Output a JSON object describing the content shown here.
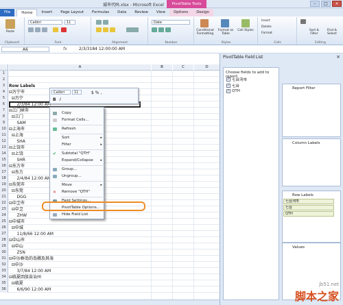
{
  "window": {
    "title": "城市代码.xlsx - Microsoft Excel",
    "contextual_tab": "PivotTable Tools",
    "buttons": [
      "–",
      "□",
      "×"
    ]
  },
  "ribbon_tabs": [
    "File",
    "Home",
    "Insert",
    "Page Layout",
    "Formulas",
    "Data",
    "Review",
    "View",
    "Options",
    "Design"
  ],
  "ribbon": {
    "clipboard": {
      "paste": "Paste",
      "label": "Clipboard"
    },
    "font": {
      "family": "Calibri",
      "size": "11",
      "label": "Font"
    },
    "alignment": {
      "label": "Alignment"
    },
    "number": {
      "format": "Date",
      "label": "Number"
    },
    "styles": {
      "conditional": "Conditional Formatting",
      "format_table": "Format as Table",
      "cell_styles": "Cell Styles",
      "label": "Styles"
    },
    "cells": {
      "insert": "Insert",
      "delete": "Delete",
      "format": "Format",
      "label": "Cells"
    },
    "editing": {
      "sort": "Sort & Filter",
      "find": "Find & Select",
      "label": "Editing"
    }
  },
  "formula_bar": {
    "name_box": "A6",
    "fx": "fx",
    "value": "2/3/3184 12:00:00 AM"
  },
  "sheet": {
    "columns": [
      "A",
      "B",
      "C",
      "D"
    ],
    "rows": [
      {
        "n": "1",
        "text": ""
      },
      {
        "n": "2",
        "text": ""
      },
      {
        "n": "3",
        "text": "Row Labels"
      },
      {
        "n": "4",
        "text": "⊟万宁市"
      },
      {
        "n": "5",
        "text": "  ⊟万宁"
      },
      {
        "n": "6",
        "text": "      2/3/84 12:00 AM"
      },
      {
        "n": "7",
        "text": "⊟三门峡市"
      },
      {
        "n": "8",
        "text": "  ⊟三门"
      },
      {
        "n": "9",
        "text": "      SAM"
      },
      {
        "n": "10",
        "text": "⊟上海市"
      },
      {
        "n": "11",
        "text": "  ⊟上海"
      },
      {
        "n": "12",
        "text": "      SHA"
      },
      {
        "n": "13",
        "text": "⊟上饶市"
      },
      {
        "n": "14",
        "text": "  ⊟上饶"
      },
      {
        "n": "15",
        "text": "      SHR"
      },
      {
        "n": "16",
        "text": "⊟东方市"
      },
      {
        "n": "17",
        "text": "  ⊟东方"
      },
      {
        "n": "18",
        "text": "      2/4/84 12:00 AM"
      },
      {
        "n": "19",
        "text": "⊟东莞市"
      },
      {
        "n": "20",
        "text": "  ⊟东莞"
      },
      {
        "n": "21",
        "text": "      DGG"
      },
      {
        "n": "22",
        "text": "⊟中卫市"
      },
      {
        "n": "23",
        "text": "  ⊟中卫"
      },
      {
        "n": "24",
        "text": "      ZHW"
      },
      {
        "n": "25",
        "text": "⊟中城市"
      },
      {
        "n": "26",
        "text": "  ⊟中城"
      },
      {
        "n": "27",
        "text": "      11/8/66 12:00 AM"
      },
      {
        "n": "28",
        "text": "⊟中山市"
      },
      {
        "n": "29",
        "text": "  ⊟中山"
      },
      {
        "n": "30",
        "text": "      ZSN"
      },
      {
        "n": "31",
        "text": "⊟中沙群岛的岛礁及其海"
      },
      {
        "n": "32",
        "text": "  ⊟中沙"
      },
      {
        "n": "33",
        "text": "      3/7/84 12:00 AM"
      },
      {
        "n": "34",
        "text": "⊟临夏回族自治州"
      },
      {
        "n": "35",
        "text": "  ⊟临夏"
      },
      {
        "n": "36",
        "text": "      6/6/90 12:00 AM"
      }
    ]
  },
  "mini_toolbar": {
    "font": "Calibri",
    "size": "11",
    "bold": "B",
    "italic": "I",
    "symbols": "$ % ,"
  },
  "context_menu": [
    {
      "label": "Copy",
      "arrow": ""
    },
    {
      "label": "Format Cells...",
      "arrow": ""
    },
    {
      "label": "Refresh",
      "arrow": ""
    },
    {
      "label": "Sort",
      "arrow": "▸"
    },
    {
      "label": "Filter",
      "arrow": "▸"
    },
    {
      "label": "Subtotal \"QTH\"",
      "arrow": ""
    },
    {
      "label": "Expand/Collapse",
      "arrow": "▸"
    },
    {
      "label": "Group...",
      "arrow": ""
    },
    {
      "label": "Ungroup...",
      "arrow": ""
    },
    {
      "label": "Move",
      "arrow": "▸"
    },
    {
      "label": "Remove \"QTH\"",
      "arrow": ""
    },
    {
      "label": "Field Settings...",
      "arrow": ""
    },
    {
      "label": "PivotTable Options...",
      "arrow": ""
    },
    {
      "label": "Hide Field List",
      "arrow": ""
    }
  ],
  "field_list": {
    "title": "PivotTable Field List",
    "choose_label": "Choose fields to add to report:",
    "fields": [
      "七台河市",
      "七台",
      "QTH"
    ],
    "report_filter": "Report Filter",
    "column_labels": "Column Labels",
    "row_labels": "Row Labels",
    "row_fields": [
      "七台河市",
      "七台",
      "QTH"
    ],
    "values": "Values"
  },
  "watermark": {
    "brand": "jb51.net",
    "cn": "脚本之家"
  }
}
